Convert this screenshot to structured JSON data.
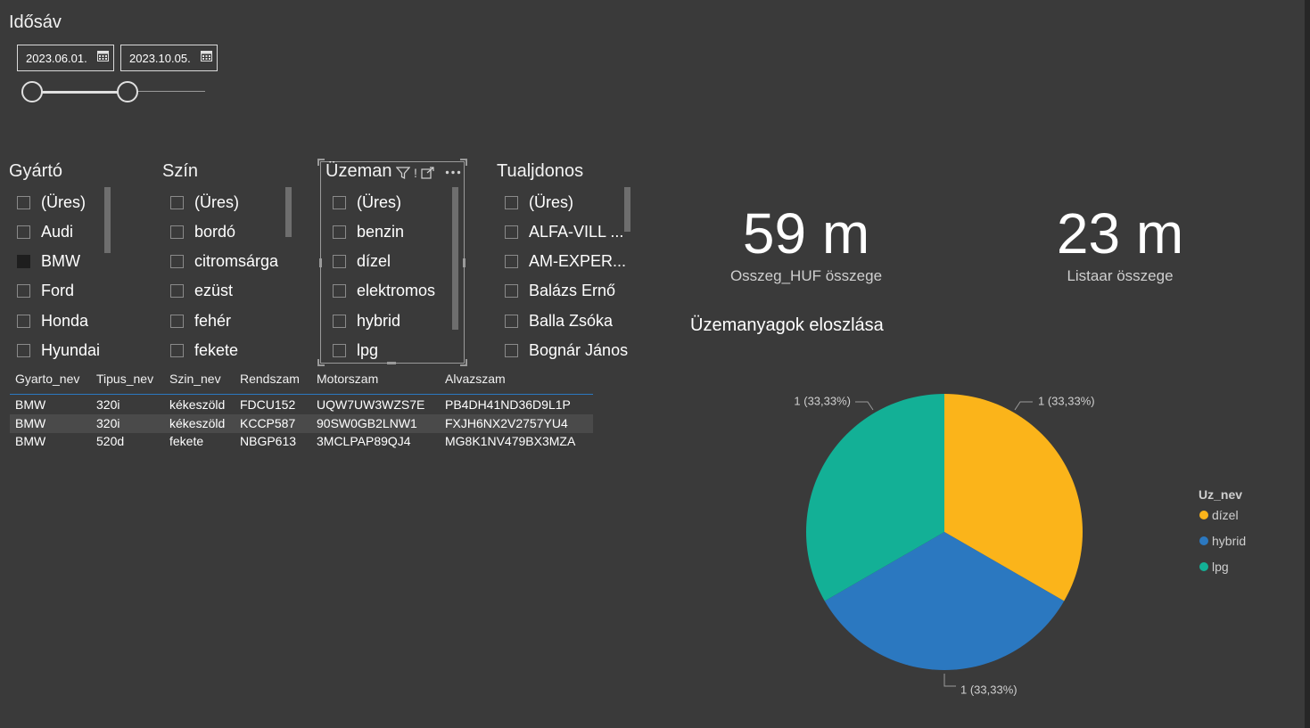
{
  "date_slicer": {
    "title": "Idősáv",
    "start": "2023.06.01.",
    "end": "2023.10.05."
  },
  "slicers": {
    "gyarto": {
      "title": "Gyártó",
      "items": [
        {
          "label": "(Üres)",
          "checked": false
        },
        {
          "label": "Audi",
          "checked": false
        },
        {
          "label": "BMW",
          "checked": true
        },
        {
          "label": "Ford",
          "checked": false
        },
        {
          "label": "Honda",
          "checked": false
        },
        {
          "label": "Hyundai",
          "checked": false
        }
      ]
    },
    "szin": {
      "title": "Szín",
      "items": [
        {
          "label": "(Üres)",
          "checked": false
        },
        {
          "label": "bordó",
          "checked": false
        },
        {
          "label": "citromsárga",
          "checked": false
        },
        {
          "label": "ezüst",
          "checked": false
        },
        {
          "label": "fehér",
          "checked": false
        },
        {
          "label": "fekete",
          "checked": false
        }
      ]
    },
    "uzemanyag": {
      "title": "Üzeman",
      "items": [
        {
          "label": "(Üres)",
          "checked": false
        },
        {
          "label": "benzin",
          "checked": false
        },
        {
          "label": "dízel",
          "checked": false
        },
        {
          "label": "elektromos",
          "checked": false
        },
        {
          "label": "hybrid",
          "checked": false
        },
        {
          "label": "lpg",
          "checked": false
        }
      ]
    },
    "tulajdonos": {
      "title": "Tualjdonos",
      "items": [
        {
          "label": "(Üres)",
          "checked": false
        },
        {
          "label": "ALFA-VILL ...",
          "checked": false
        },
        {
          "label": "AM-EXPER...",
          "checked": false
        },
        {
          "label": "Balázs Ernő",
          "checked": false
        },
        {
          "label": "Balla Zsóka",
          "checked": false
        },
        {
          "label": "Bognár János",
          "checked": false
        }
      ]
    }
  },
  "table": {
    "headers": [
      "Gyarto_nev",
      "Tipus_nev",
      "Szin_nev",
      "Rendszam",
      "Motorszam",
      "Alvazszam"
    ],
    "rows": [
      [
        "BMW",
        "320i",
        "kékeszöld",
        "FDCU152",
        "UQW7UW3WZS7E",
        "PB4DH41ND36D9L1P"
      ],
      [
        "BMW",
        "320i",
        "kékeszöld",
        "KCCP587",
        "90SW0GB2LNW1",
        "FXJH6NX2V2757YU4"
      ],
      [
        "BMW",
        "520d",
        "fekete",
        "NBGP613",
        "3MCLPAP89QJ4",
        "MG8K1NV479BX3MZA"
      ]
    ]
  },
  "kpis": [
    {
      "value": "59 m",
      "label": "Osszeg_HUF összege"
    },
    {
      "value": "23 m",
      "label": "Listaar összege"
    }
  ],
  "chart_data": {
    "type": "pie",
    "title": "Üzemanyagok eloszlása",
    "legend_title": "Uz_nev",
    "legend_position": "right",
    "categories": [
      "dízel",
      "hybrid",
      "lpg"
    ],
    "values": [
      1,
      1,
      1
    ],
    "data_labels": [
      "1 (33,33%)",
      "1 (33,33%)",
      "1 (33,33%)"
    ],
    "colors": [
      "#fbb41a",
      "#2b78c0",
      "#13b096"
    ]
  },
  "colors": {
    "background": "#3a3a3a",
    "slider_accent": "#e0e0e0",
    "table_header_line": "#2b78c0"
  }
}
